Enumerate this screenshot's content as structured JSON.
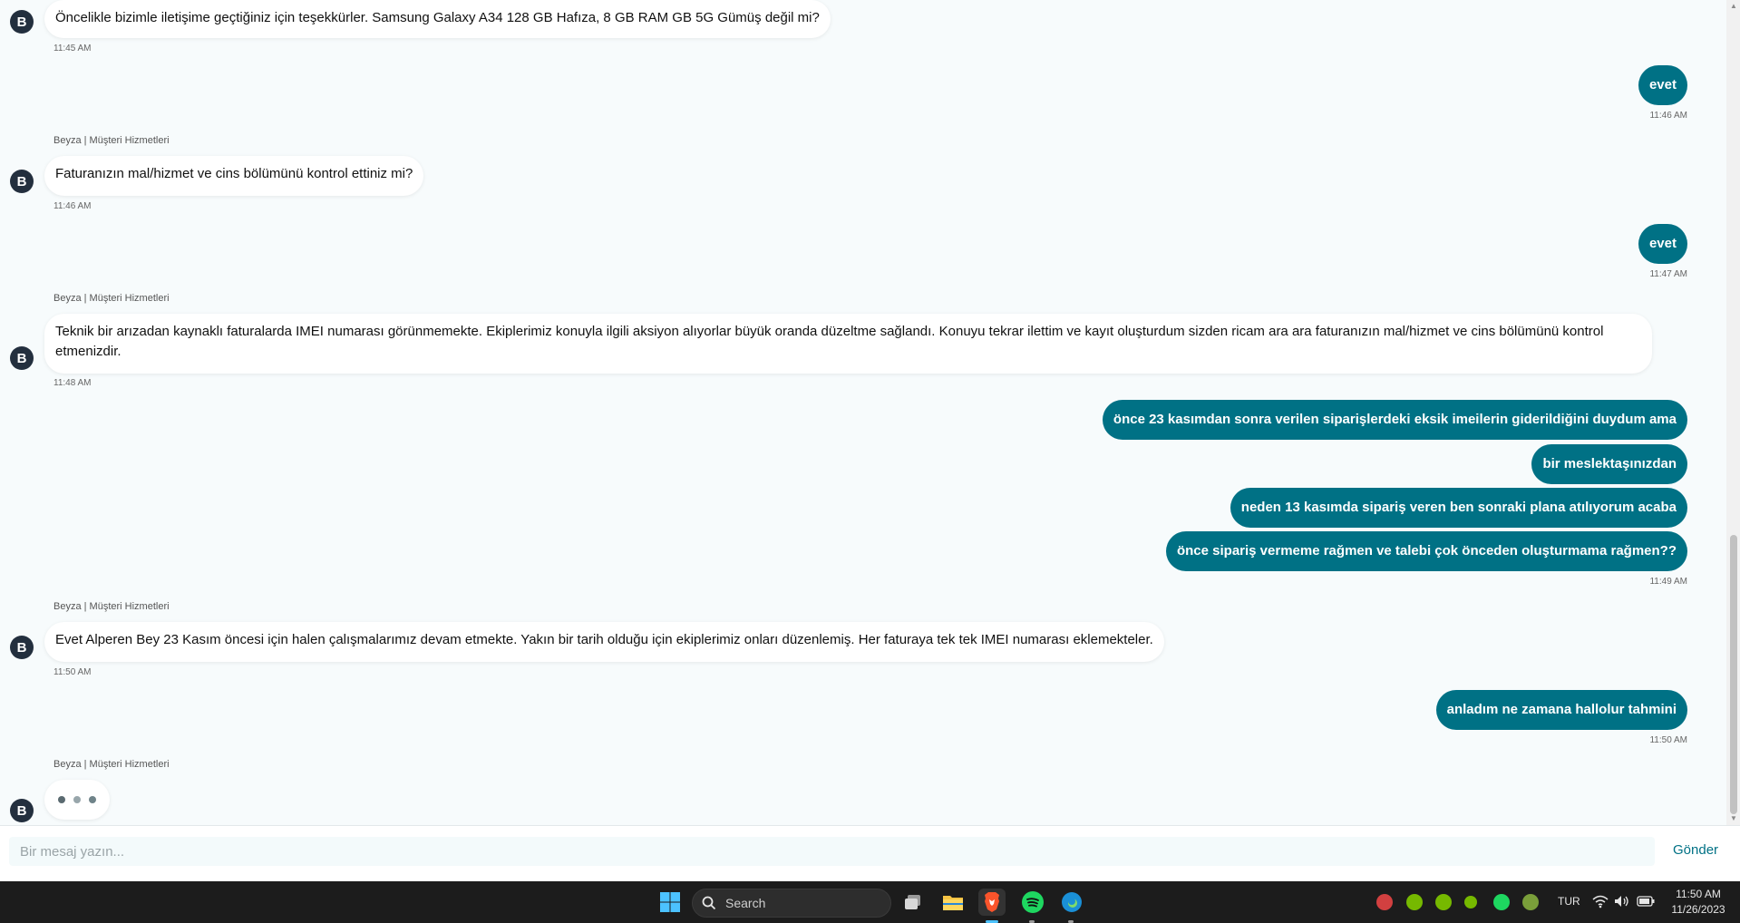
{
  "agent": {
    "initial": "B",
    "name": "Beyza | Müşteri Hizmetleri"
  },
  "messages": [
    {
      "sender": "agent",
      "text": "Öncelikle bizimle iletişime geçtiğiniz için teşekkürler. Samsung Galaxy A34 128 GB Hafıza, 8 GB RAM GB 5G Gümüş değil mi?",
      "time": "11:45 AM"
    },
    {
      "sender": "user",
      "text": "evet",
      "time": "11:46 AM"
    },
    {
      "sender": "agent",
      "text": "Faturanızın mal/hizmet ve cins bölümünü kontrol ettiniz mi?",
      "time": "11:46 AM"
    },
    {
      "sender": "user",
      "text": "evet",
      "time": "11:47 AM"
    },
    {
      "sender": "agent",
      "text": "Teknik bir arızadan kaynaklı faturalarda IMEI numarası görünmemekte. Ekiplerimiz konuyla ilgili aksiyon alıyorlar büyük oranda düzeltme sağlandı. Konuyu tekrar ilettim ve kayıt oluşturdum sizden ricam ara ara faturanızın mal/hizmet ve cins bölümünü kontrol etmenizdir.",
      "time": "11:48 AM"
    },
    {
      "sender": "user",
      "text": "önce 23 kasımdan sonra verilen siparişlerdeki eksik imeilerin giderildiğini duydum ama"
    },
    {
      "sender": "user",
      "text": "bir meslektaşınızdan"
    },
    {
      "sender": "user",
      "text": "neden 13 kasımda sipariş veren ben sonraki plana atılıyorum acaba"
    },
    {
      "sender": "user",
      "text": "önce sipariş vermeme rağmen ve talebi çok önceden oluşturmama rağmen??",
      "time": "11:49 AM"
    },
    {
      "sender": "agent",
      "text": "Evet Alperen Bey 23 Kasım öncesi için halen çalışmalarımız devam etmekte. Yakın bir tarih olduğu için ekiplerimiz onları düzenlemiş. Her faturaya tek tek IMEI numarası eklemekteler.",
      "time": "11:50 AM"
    },
    {
      "sender": "user",
      "text": "anladım ne zamana hallolur tahmini",
      "time": "11:50 AM"
    }
  ],
  "composer": {
    "placeholder": "Bir mesaj yazın...",
    "send_label": "Gönder"
  },
  "taskbar": {
    "search_label": "Search",
    "language": "TUR",
    "time": "11:50 AM",
    "date": "11/26/2023"
  },
  "colors": {
    "user_bubble": "#007185",
    "avatar": "#232f3e",
    "taskbar": "#1c1c1c"
  }
}
